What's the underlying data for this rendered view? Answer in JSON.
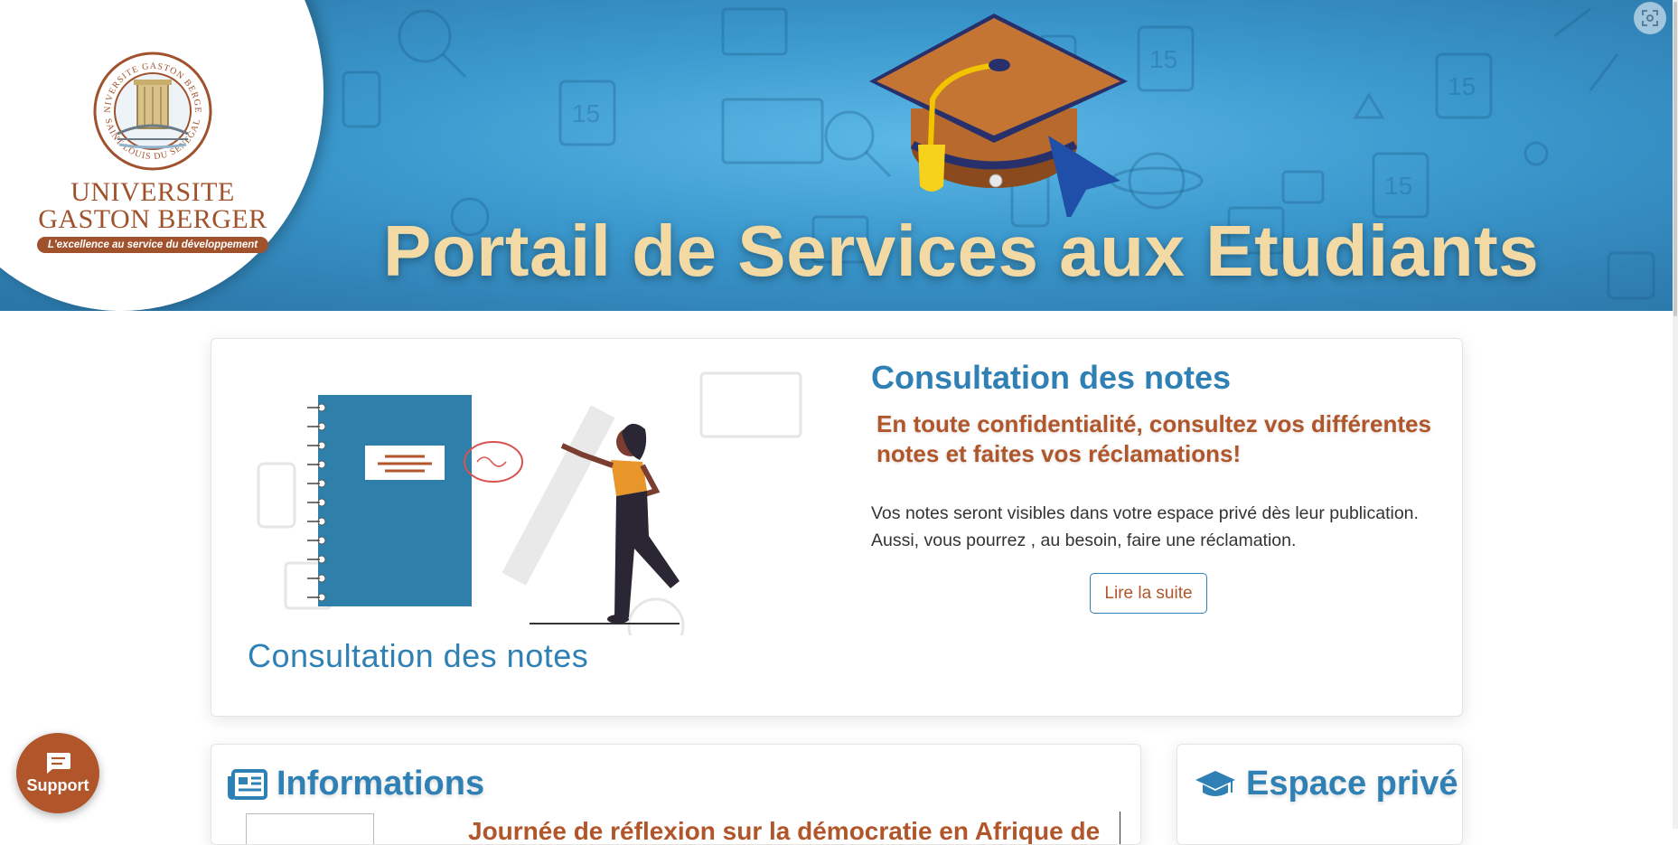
{
  "header": {
    "university_line1": "UNIVERSITE",
    "university_line2": "GASTON BERGER",
    "slogan": "L'excellence au service du développement",
    "seal_text_top": "UNIVERSITE GASTON BERGER",
    "seal_text_bottom": "SAINT-LOUIS DU SENEGAL",
    "title": "Portail de Services aux Etudiants",
    "fullscreen_icon": "fullscreen-icon"
  },
  "feature_card": {
    "illustration_caption": "Consultation des notes",
    "title": "Consultation des notes",
    "subtitle": "En toute confidentialité, consultez vos différentes notes et faites vos réclamations!",
    "body_line1": "Vos notes seront visibles dans votre espace privé dès leur publication.",
    "body_line2": "Aussi, vous pourrez , au besoin, faire une réclamation.",
    "read_more_label": "Lire la suite"
  },
  "informations": {
    "heading": "Informations",
    "icon": "newspaper-icon",
    "first_item_title": "Journée de réflexion sur la démocratie en Afrique de"
  },
  "espace_prive": {
    "heading": "Espace privé",
    "icon": "graduation-cap-icon"
  },
  "support": {
    "label": "Support",
    "icon": "chat-icon"
  },
  "colors": {
    "primary_blue": "#2f80b4",
    "accent_brown": "#b0562a",
    "title_cream": "#f3d9a4"
  }
}
